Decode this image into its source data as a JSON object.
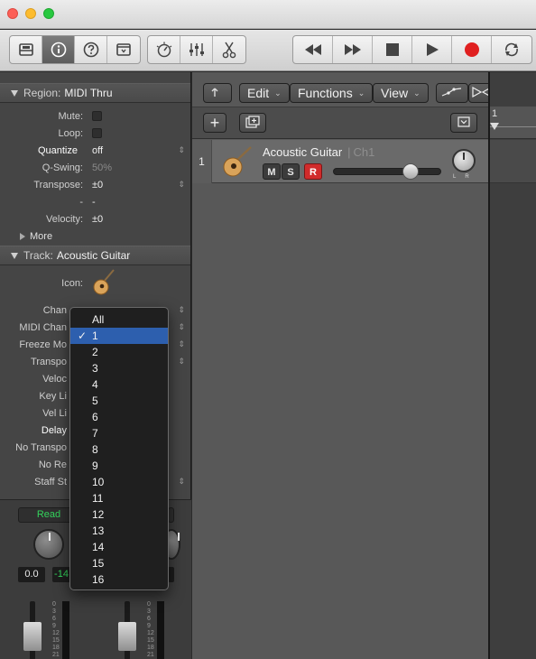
{
  "toolbar": {
    "left_icons": [
      "library-icon",
      "info-icon",
      "help-icon",
      "editors-icon"
    ],
    "mid_icons": [
      "smart-controls-icon",
      "mixer-icon",
      "scissors-icon"
    ],
    "transport_icons": [
      "rewind-icon",
      "fast-forward-icon",
      "stop-icon",
      "play-icon",
      "record-icon",
      "cycle-icon"
    ]
  },
  "region": {
    "header_label": "Region:",
    "header_value": "MIDI Thru",
    "mute_label": "Mute:",
    "loop_label": "Loop:",
    "quantize_label": "Quantize",
    "quantize_value": "off",
    "qswing_label": "Q-Swing:",
    "qswing_value": "50%",
    "transpose_label": "Transpose:",
    "transpose_value": "±0",
    "blank_label": "-",
    "blank_value": "-",
    "velocity_label": "Velocity:",
    "velocity_value": "±0",
    "more_label": "More"
  },
  "track": {
    "header_label": "Track:",
    "header_value": "Acoustic Guitar",
    "icon_label": "Icon:",
    "rows": [
      "Chan",
      "MIDI Chan",
      "Freeze Mo",
      "Transpo",
      "Veloc",
      "Key Li",
      "Vel Li",
      "Delay",
      "No Transpo",
      "No Re",
      "Staff St"
    ]
  },
  "mixer": {
    "read_label": "Read",
    "left_value": "0.0",
    "right_value": "-14",
    "scale": [
      "0",
      "3",
      "6",
      "9",
      "12",
      "15",
      "18",
      "21"
    ]
  },
  "tracks_toolbar": {
    "edit_label": "Edit",
    "functions_label": "Functions",
    "view_label": "View"
  },
  "track_row": {
    "number": "1",
    "name": "Acoustic Guitar",
    "channel": "Ch1",
    "mute": "M",
    "solo": "S",
    "record": "R",
    "volume_fraction": 0.72,
    "pan_left": "L",
    "pan_right": "R"
  },
  "ruler": {
    "bar": "1"
  },
  "dropdown": {
    "selected": "1",
    "options": [
      "All",
      "1",
      "2",
      "3",
      "4",
      "5",
      "6",
      "7",
      "8",
      "9",
      "10",
      "11",
      "12",
      "13",
      "14",
      "15",
      "16"
    ]
  },
  "colors": {
    "record": "#d12b2b",
    "selection": "#2d5fae",
    "read": "#34d45c"
  }
}
